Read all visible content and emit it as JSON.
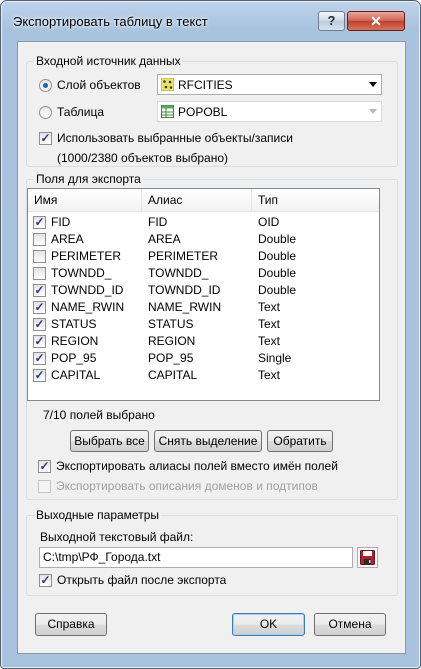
{
  "window": {
    "title": "Экспортировать таблицу в текст",
    "help_label": "?",
    "close_label": "✕"
  },
  "source": {
    "group_label": "Входной источник данных",
    "layer_radio_label": "Слой объектов",
    "layer_value": "RFCITIES",
    "table_radio_label": "Таблица",
    "table_value": "POPOBL",
    "use_selected_label": "Использовать выбранные объекты/записи",
    "selected_info": "(1000/2380 объектов выбрано)"
  },
  "fields": {
    "group_label": "Поля для экспорта",
    "columns": [
      "Имя",
      "Алиас",
      "Тип"
    ],
    "rows": [
      {
        "checked": true,
        "name": "FID",
        "alias": "FID",
        "type": "OID"
      },
      {
        "checked": false,
        "name": "AREA",
        "alias": "AREA",
        "type": "Double"
      },
      {
        "checked": false,
        "name": "PERIMETER",
        "alias": "PERIMETER",
        "type": "Double"
      },
      {
        "checked": false,
        "name": "TOWNDD_",
        "alias": "TOWNDD_",
        "type": "Double"
      },
      {
        "checked": true,
        "name": "TOWNDD_ID",
        "alias": "TOWNDD_ID",
        "type": "Double"
      },
      {
        "checked": true,
        "name": "NAME_RWIN",
        "alias": "NAME_RWIN",
        "type": "Text"
      },
      {
        "checked": true,
        "name": "STATUS",
        "alias": "STATUS",
        "type": "Text"
      },
      {
        "checked": true,
        "name": "REGION",
        "alias": "REGION",
        "type": "Text"
      },
      {
        "checked": true,
        "name": "POP_95",
        "alias": "POP_95",
        "type": "Single"
      },
      {
        "checked": true,
        "name": "CAPITAL",
        "alias": "CAPITAL",
        "type": "Text"
      }
    ],
    "count_text": "7/10 полей выбрано",
    "select_all_label": "Выбрать все",
    "clear_selection_label": "Снять выделение",
    "invert_label": "Обратить",
    "export_aliases_label": "Экспортировать алиасы полей вместо имён полей",
    "export_domains_label": "Экспортировать описания доменов и подтипов"
  },
  "output": {
    "group_label": "Выходные параметры",
    "file_label": "Выходной текстовый файл:",
    "file_value": "C:\\tmp\\РФ_Города.txt",
    "open_after_label": "Открыть файл после экспорта"
  },
  "footer": {
    "help_label": "Справка",
    "ok_label": "OK",
    "cancel_label": "Отмена"
  }
}
